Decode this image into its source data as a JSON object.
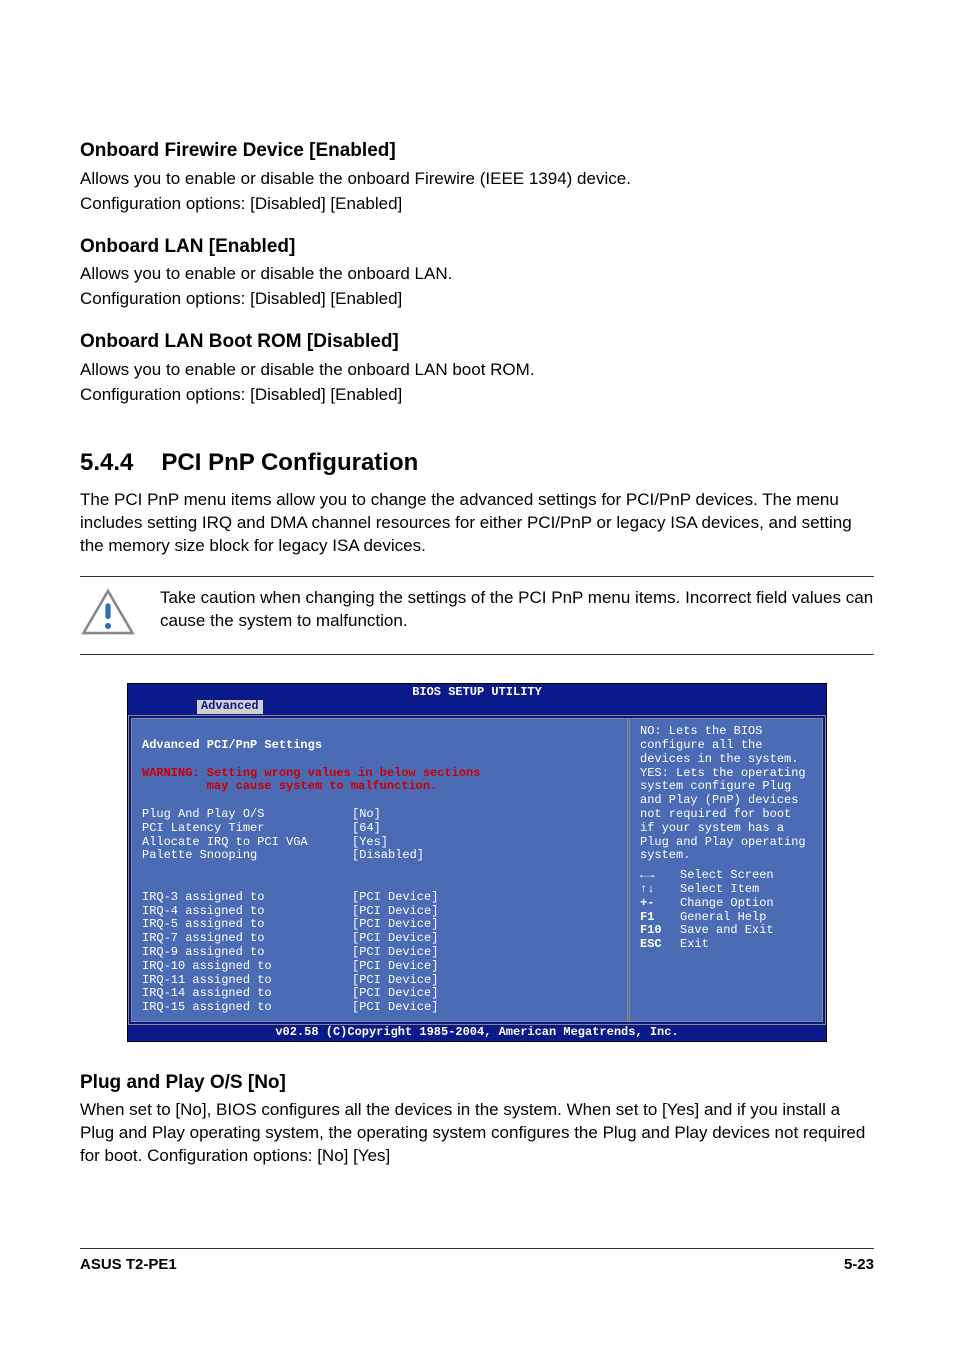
{
  "sections": {
    "firewire": {
      "heading": "Onboard Firewire Device [Enabled]",
      "line1": "Allows you to enable or disable the onboard Firewire (IEEE 1394) device.",
      "line2": "Configuration options: [Disabled] [Enabled]"
    },
    "lan": {
      "heading": "Onboard LAN [Enabled]",
      "line1": "Allows you to enable or disable the onboard LAN.",
      "line2": "Configuration options: [Disabled] [Enabled]"
    },
    "lanrom": {
      "heading": "Onboard LAN Boot ROM [Disabled]",
      "line1": "Allows you to enable or disable the onboard LAN boot ROM.",
      "line2": "Configuration options: [Disabled] [Enabled]"
    }
  },
  "major": {
    "num": "5.4.4",
    "title": "PCI PnP Configuration",
    "intro": "The PCI PnP menu items allow you to change the advanced settings for PCI/PnP devices. The menu includes setting IRQ and DMA channel resources for either PCI/PnP or legacy ISA devices, and setting the memory size block for legacy ISA devices."
  },
  "caution": "Take caution when changing the settings of the PCI PnP menu items. Incorrect field values can cause the system to malfunction.",
  "bios": {
    "title": "BIOS SETUP UTILITY",
    "tab": "Advanced",
    "panel_heading": "Advanced PCI/PnP Settings",
    "warning1": "WARNING: Setting wrong values in below sections",
    "warning2": "         may cause system to malfunction.",
    "settings": [
      {
        "label": "Plug And Play O/S",
        "value": "[No]"
      },
      {
        "label": "PCI Latency Timer",
        "value": "[64]"
      },
      {
        "label": "Allocate IRQ to PCI VGA",
        "value": "[Yes]"
      },
      {
        "label": "Palette Snooping",
        "value": "[Disabled]"
      }
    ],
    "irqs": [
      {
        "label": "IRQ-3 assigned to",
        "value": "[PCI Device]"
      },
      {
        "label": "IRQ-4 assigned to",
        "value": "[PCI Device]"
      },
      {
        "label": "IRQ-5 assigned to",
        "value": "[PCI Device]"
      },
      {
        "label": "IRQ-7 assigned to",
        "value": "[PCI Device]"
      },
      {
        "label": "IRQ-9 assigned to",
        "value": "[PCI Device]"
      },
      {
        "label": "IRQ-10 assigned to",
        "value": "[PCI Device]"
      },
      {
        "label": "IRQ-11 assigned to",
        "value": "[PCI Device]"
      },
      {
        "label": "IRQ-14 assigned to",
        "value": "[PCI Device]"
      },
      {
        "label": "IRQ-15 assigned to",
        "value": "[PCI Device]"
      }
    ],
    "help_text": "NO: Lets the BIOS configure all the devices in the system. YES: Lets the operating system configure Plug and Play (PnP) devices not required for boot if your system has a Plug and Play operating system.",
    "keys": [
      {
        "k": "←→",
        "d": "Select Screen"
      },
      {
        "k": "↑↓",
        "d": "Select Item"
      },
      {
        "k": "+-",
        "d": "Change Option"
      },
      {
        "k": "F1",
        "d": "General Help"
      },
      {
        "k": "F10",
        "d": "Save and Exit"
      },
      {
        "k": "ESC",
        "d": "Exit"
      }
    ],
    "footer": "v02.58 (C)Copyright 1985-2004, American Megatrends, Inc."
  },
  "pnp": {
    "heading": "Plug and Play O/S [No]",
    "body": "When set to [No], BIOS configures all the devices in the system. When set to [Yes] and if you install a Plug and Play operating system, the operating system configures the Plug and Play devices not required for boot. Configuration options: [No] [Yes]"
  },
  "footer": {
    "left": "ASUS T2-PE1",
    "right": "5-23"
  }
}
